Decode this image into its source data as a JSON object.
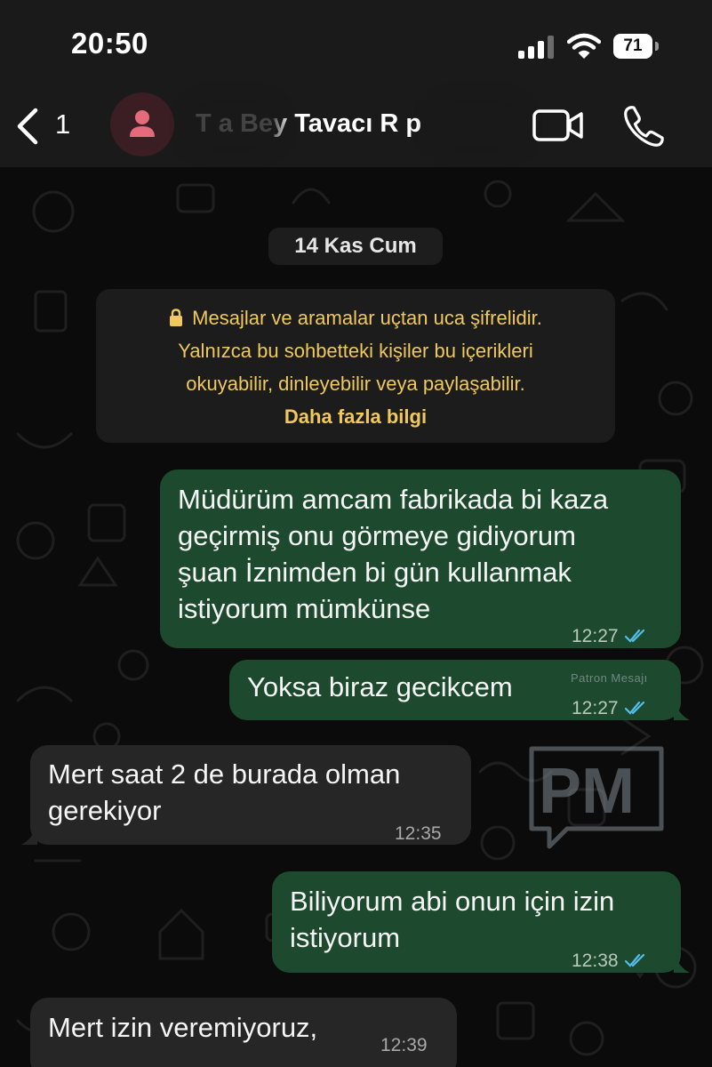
{
  "status_bar": {
    "time": "20:50",
    "battery_level": "71",
    "icons": [
      "cellular-signal-icon",
      "wifi-icon",
      "battery-icon"
    ]
  },
  "header": {
    "back_icon": "chevron-left-icon",
    "unread_count": "1",
    "contact_name": "T a Bey Tavacı R p",
    "avatar_icon": "person-icon",
    "video_call_icon": "video-camera-icon",
    "voice_call_icon": "phone-icon"
  },
  "chat": {
    "date_separator": "14 Kas Cum",
    "encryption_notice": {
      "icon": "lock-icon",
      "line1": "Mesajlar ve aramalar uçtan uca şifrelidir.",
      "line2": "Yalnızca bu sohbetteki kişiler bu içerikleri",
      "line3": "okuyabilir, dinleyebilir veya paylaşabilir.",
      "link": "Daha fazla bilgi"
    },
    "messages": [
      {
        "direction": "outgoing",
        "lines": [
          "Müdürüm amcam fabrikada bi kaza",
          "geçirmiş onu görmeye gidiyorum",
          "şuan İznimden bi gün kullanmak",
          "istiyorum mümkünse"
        ],
        "time": "12:27",
        "status": "read"
      },
      {
        "direction": "outgoing",
        "lines": [
          "Yoksa biraz gecikcem"
        ],
        "time": "12:27",
        "status": "read"
      },
      {
        "direction": "incoming",
        "lines": [
          "Mert saat 2 de burada olman",
          "gerekiyor"
        ],
        "time": "12:35"
      },
      {
        "direction": "outgoing",
        "lines": [
          "Biliyorum abi onun için izin",
          "istiyorum"
        ],
        "time": "12:38",
        "status": "read"
      },
      {
        "direction": "incoming",
        "lines": [
          "Mert izin veremiyoruz,"
        ],
        "time": "12:39"
      }
    ]
  },
  "watermark": {
    "letters": "PM",
    "caption": "Patron Mesajı"
  },
  "colors": {
    "background": "#0b0b0b",
    "bar_background": "#1a1a1a",
    "outgoing_bubble": "#1d4a2e",
    "incoming_bubble": "#262626",
    "encryption_text": "#f0c95c",
    "read_ticks": "#53bdeb",
    "avatar_background": "#3a1e24",
    "avatar_icon": "#e46b7c"
  }
}
